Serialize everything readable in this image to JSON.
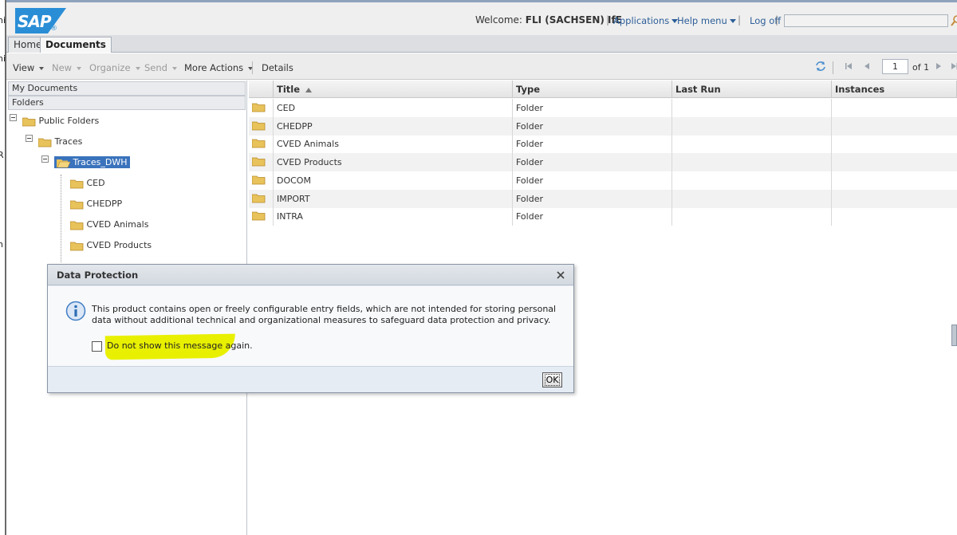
{
  "left_bleed": [
    "hi",
    "ni",
    "R",
    "n"
  ],
  "header": {
    "logo_text": "SAP",
    "logo_mark": "®",
    "welcome_label": "Welcome:",
    "user_name": "FLI (SACHSEN) IfE",
    "applications": "Applications",
    "help_menu": "Help menu",
    "log_off": "Log off",
    "search_value": ""
  },
  "tabs": [
    {
      "label": "Home"
    },
    {
      "label": "Documents"
    }
  ],
  "toolbar": {
    "view": "View",
    "new": "New",
    "organize": "Organize",
    "send": "Send",
    "more_actions": "More Actions",
    "details": "Details",
    "page_value": "1",
    "page_of": "of 1"
  },
  "left_panel": {
    "my_documents": "My Documents",
    "folders": "Folders",
    "tree": {
      "public_folders": "Public Folders",
      "traces": "Traces",
      "traces_dwh": "Traces_DWH",
      "children": [
        "CED",
        "CHEDPP",
        "CVED Animals",
        "CVED Products"
      ]
    }
  },
  "grid": {
    "columns": [
      "Title",
      "Type",
      "Last Run",
      "Instances"
    ],
    "rows": [
      {
        "title": "CED",
        "type": "Folder"
      },
      {
        "title": "CHEDPP",
        "type": "Folder"
      },
      {
        "title": "CVED Animals",
        "type": "Folder"
      },
      {
        "title": "CVED Products",
        "type": "Folder"
      },
      {
        "title": "DOCOM",
        "type": "Folder"
      },
      {
        "title": "IMPORT",
        "type": "Folder"
      },
      {
        "title": "INTRA",
        "type": "Folder"
      }
    ]
  },
  "dialog": {
    "title": "Data Protection",
    "message": "This product contains open or freely configurable entry fields, which are not intended for storing personal data without additional technical and organizational measures to safeguard data protection and privacy.",
    "checkbox_label": "Do not show this message again.",
    "ok_label": "OK"
  },
  "colors": {
    "brand_blue": "#2a8ed6",
    "link_blue": "#2c5e98",
    "selection_blue": "#3a73bc",
    "highlight_yellow": "#e8f000",
    "folder_yellow": "#e8c25a"
  }
}
